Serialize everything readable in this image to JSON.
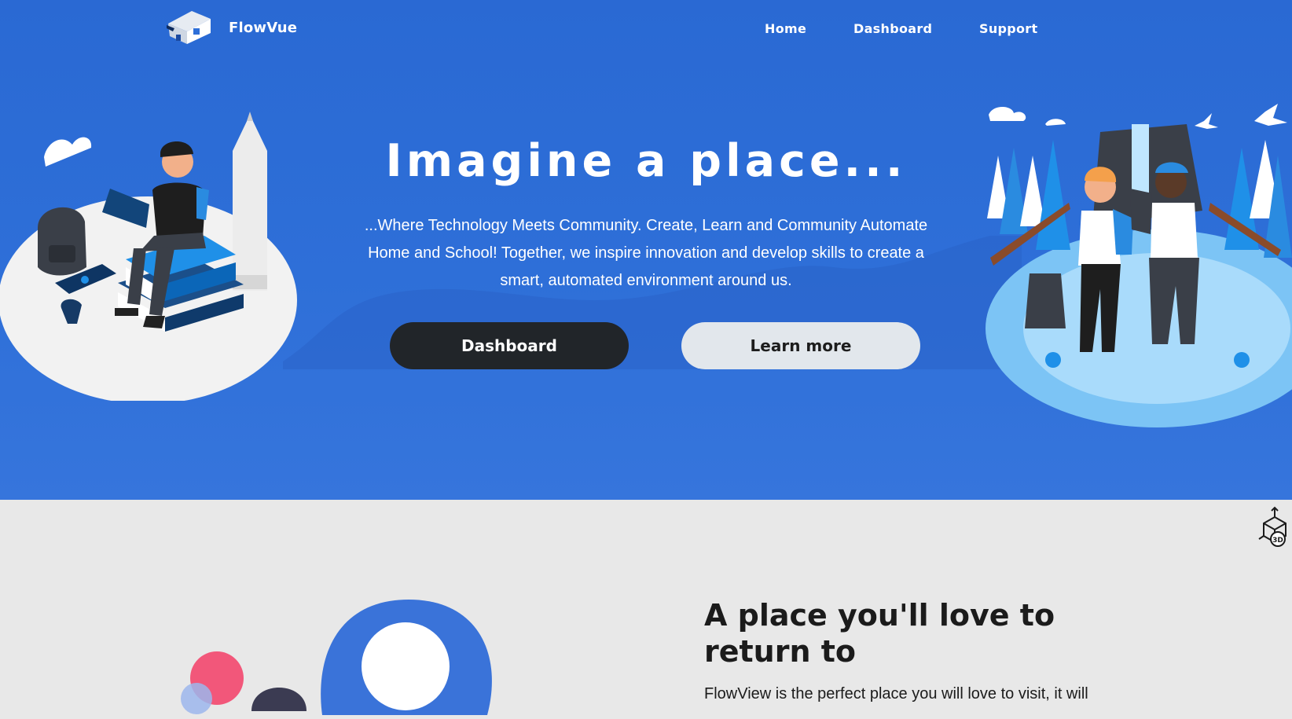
{
  "nav": {
    "brand": "FlowVue",
    "links": [
      "Home",
      "Dashboard",
      "Support"
    ]
  },
  "hero": {
    "title": "Imagine a place...",
    "text": "...Where Technology Meets Community. Create, Learn and Community Automate Home and School! Together, we inspire innovation and develop skills to create a smart, automated environment around us.",
    "primary_button": "Dashboard",
    "secondary_button": "Learn more"
  },
  "section": {
    "title": "A place you'll love to return to",
    "text": "FlowView is the perfect place you will love to visit, it will"
  },
  "icons": {
    "logo": "school-house-logo",
    "corner": "3d-cube-icon"
  },
  "colors": {
    "hero_bg": "#2e6fd8",
    "primary_button": "#212529",
    "secondary_button": "#e2e7ec",
    "section_bg": "#e8e8e8",
    "accent_pink": "#f2577a"
  }
}
